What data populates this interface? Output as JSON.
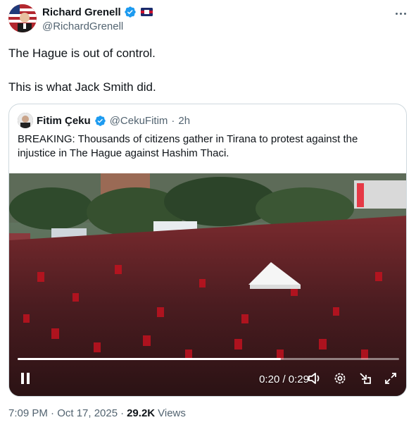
{
  "author": {
    "display_name": "Richard Grenell",
    "handle": "@RichardGrenell",
    "verified_icon": "verified-badge-icon",
    "affiliation_icon": "flag-badge-icon"
  },
  "tweet": {
    "line1": "The Hague is out of control.",
    "line2": "This is what Jack Smith did."
  },
  "quoted": {
    "display_name": "Fitim Çeku",
    "handle": "@CekuFitim",
    "separator": "·",
    "time": "2h",
    "text": "BREAKING: Thousands of citizens gather in Tirana to protest against the injustice in The Hague against Hashim Thaci."
  },
  "video": {
    "time_display": "0:20 / 0:29",
    "progress": 0.69,
    "controls": [
      "pause-icon",
      "volume-icon",
      "settings-icon",
      "minimize-icon",
      "fullscreen-icon"
    ]
  },
  "footer": {
    "timestamp": "7:09 PM · Oct 17, 2025",
    "separator": "·",
    "views_count": "29.2K",
    "views_label": "Views"
  },
  "colors": {
    "verified_blue": "#1d9bf0",
    "secondary_text": "#536471",
    "border": "#cfd9de"
  }
}
